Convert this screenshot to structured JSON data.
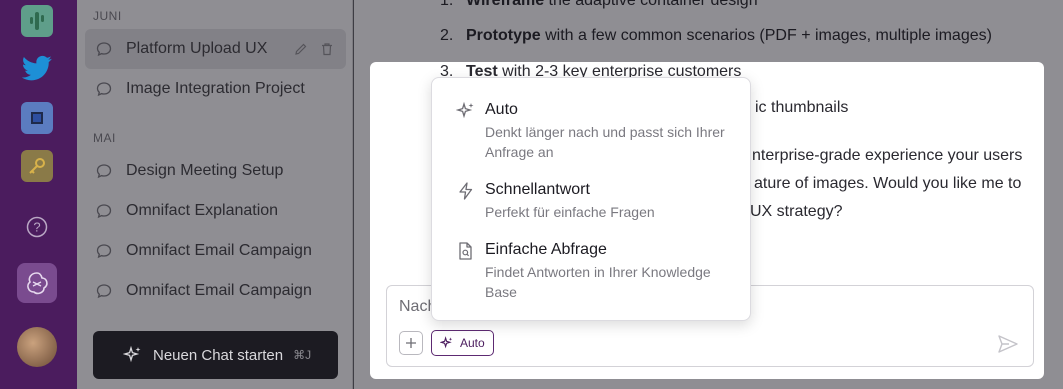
{
  "sidebar": {
    "sections": [
      {
        "label": "JUNI",
        "items": [
          {
            "label": "Platform Upload UX",
            "active": true
          },
          {
            "label": "Image Integration Project",
            "active": false
          }
        ]
      },
      {
        "label": "MAI",
        "items": [
          {
            "label": "Design Meeting Setup",
            "active": false
          },
          {
            "label": "Omnifact Explanation",
            "active": false
          },
          {
            "label": "Omnifact Email Campaign",
            "active": false
          },
          {
            "label": "Omnifact Email Campaign",
            "active": false
          }
        ]
      }
    ],
    "new_chat": {
      "label": "Neuen Chat starten",
      "shortcut": "⌘J"
    }
  },
  "rail": {
    "icons": [
      "cactus-app-icon",
      "twitter-icon",
      "chip-app-icon",
      "key-app-icon",
      "help-icon",
      "assistant-app-icon",
      "user-avatar"
    ]
  },
  "message": {
    "list": [
      {
        "num": "1.",
        "bold": "Wireframe",
        "rest": " the adaptive container design"
      },
      {
        "num": "2.",
        "bold": "Prototype",
        "rest": " with a few common scenarios (PDF + images, multiple images)"
      },
      {
        "num": "3.",
        "bold": "Test",
        "rest": " with 2-3 key enterprise customers"
      }
    ],
    "fragments": [
      "ic thumbnails",
      "nterprise-grade experience your users",
      "ature of images. Would you like me to",
      "UX strategy?"
    ]
  },
  "composer": {
    "placeholder": "Nach",
    "mode_label": "Auto"
  },
  "dropdown": {
    "options": [
      {
        "title": "Auto",
        "desc": "Denkt länger nach und passt sich Ihrer Anfrage an",
        "icon": "sparkles-icon"
      },
      {
        "title": "Schnellantwort",
        "desc": "Perfekt für einfache Fragen",
        "icon": "lightning-icon"
      },
      {
        "title": "Einfache Abfrage",
        "desc": "Findet Antworten in Ihrer Knowledge Base",
        "icon": "document-search-icon"
      }
    ]
  },
  "colors": {
    "accent": "#4b1c5e",
    "rail": "#4b1c5e",
    "overlay": "#8f8e93"
  }
}
